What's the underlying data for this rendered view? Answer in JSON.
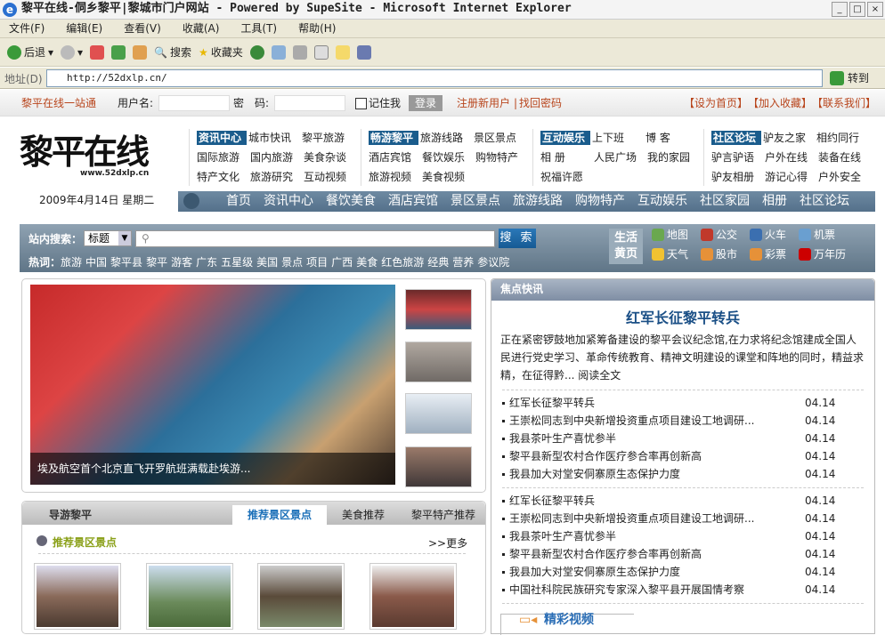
{
  "browser": {
    "title": "黎平在线-侗乡黎平|黎城市门户网站 - Powered by SupeSite - Microsoft Internet Explorer",
    "menu": [
      "文件(F)",
      "编辑(E)",
      "查看(V)",
      "收藏(A)",
      "工具(T)",
      "帮助(H)"
    ],
    "toolbar": {
      "back": "后退",
      "search": "搜索",
      "favorites": "收藏夹"
    },
    "address_label": "地址(D)",
    "address": "http://52dxlp.cn/",
    "go": "转到"
  },
  "login": {
    "site": "黎平在线一站通",
    "user_label": "用户名:",
    "pwd_label": "密　码:",
    "remember": "记住我",
    "login": "登录",
    "register": "注册新用户",
    "find_pwd": "找回密码",
    "set_home": "【设为首页】",
    "add_fav": "【加入收藏】",
    "contact": "【联系我们】"
  },
  "logo": {
    "text": "黎平在线",
    "url": "www.52dxlp.cn"
  },
  "date": "2009年4月14日 星期二",
  "categories": [
    {
      "head": "资讯中心",
      "items": [
        "城市快讯",
        "黎平旅游",
        "国际旅游",
        "国内旅游",
        "美食杂谈",
        "特产文化",
        "旅游研究",
        "互动视频"
      ]
    },
    {
      "head": "畅游黎平",
      "items": [
        "旅游线路",
        "景区景点",
        "酒店宾馆",
        "餐饮娱乐",
        "购物特产",
        "旅游视频",
        "美食视频"
      ]
    },
    {
      "head": "互动娱乐",
      "items": [
        "上下班",
        "博 客",
        "相 册",
        "人民广场",
        "我的家园",
        "祝福许愿"
      ]
    },
    {
      "head": "社区论坛",
      "items": [
        "驴友之家",
        "相约同行",
        "驴言驴语",
        "户外在线",
        "装备在线",
        "驴友相册",
        "游记心得",
        "户外安全"
      ]
    }
  ],
  "mainnav": [
    "首页",
    "资讯中心",
    "餐饮美食",
    "酒店宾馆",
    "景区景点",
    "旅游线路",
    "购物特产",
    "互动娱乐",
    "社区家园",
    "相册",
    "社区论坛"
  ],
  "search": {
    "label": "站内搜索：",
    "select": "标题",
    "button": "搜 索",
    "hot_label": "热词：",
    "hot": [
      "旅游",
      "中国",
      "黎平县",
      "黎平",
      "游客",
      "广东",
      "五星级",
      "美国",
      "景点",
      "项目",
      "广西",
      "美食",
      "红色旅游",
      "经典",
      "营养",
      "参议院"
    ]
  },
  "life": {
    "title1": "生活",
    "title2": "黄页",
    "items": [
      {
        "label": "地图",
        "icon": "map-icon",
        "color": "#6aa84f"
      },
      {
        "label": "公交",
        "icon": "bus-icon",
        "color": "#c0392b"
      },
      {
        "label": "火车",
        "icon": "train-icon",
        "color": "#3b6fb0"
      },
      {
        "label": "机票",
        "icon": "plane-icon",
        "color": "#6a9fd0"
      },
      {
        "label": "天气",
        "icon": "weather-icon",
        "color": "#f1c232"
      },
      {
        "label": "股市",
        "icon": "stock-icon",
        "color": "#e69138"
      },
      {
        "label": "彩票",
        "icon": "lottery-icon",
        "color": "#e69138"
      },
      {
        "label": "万年历",
        "icon": "clock-icon",
        "color": "#cc0000"
      }
    ]
  },
  "focus": {
    "caption": "埃及航空首个北京直飞开罗航班满载赴埃游..."
  },
  "guide": {
    "title": "导游黎平",
    "tabs": [
      "推荐景区景点",
      "美食推荐",
      "黎平特产推荐"
    ],
    "section": "推荐景区景点",
    "more": ">>更多"
  },
  "news": {
    "header": "焦点快讯",
    "headline": "红军长征黎平转兵",
    "summary": "正在紧密锣鼓地加紧筹备建设的黎平会议纪念馆,在力求将纪念馆建成全国人民进行党史学习、革命传统教育、精神文明建设的课堂和阵地的同时，精益求精，在征得黔... 阅读全文",
    "list1": [
      {
        "t": "红军长征黎平转兵",
        "d": "04.14"
      },
      {
        "t": "王崇松同志到中央新增投资重点项目建设工地调研...",
        "d": "04.14"
      },
      {
        "t": "我县茶叶生产喜忧参半",
        "d": "04.14"
      },
      {
        "t": "黎平县新型农村合作医疗参合率再创新高",
        "d": "04.14"
      },
      {
        "t": "我县加大对堂安侗寨原生态保护力度",
        "d": "04.14"
      }
    ],
    "list2": [
      {
        "t": "红军长征黎平转兵",
        "d": "04.14"
      },
      {
        "t": "王崇松同志到中央新增投资重点项目建设工地调研...",
        "d": "04.14"
      },
      {
        "t": "我县茶叶生产喜忧参半",
        "d": "04.14"
      },
      {
        "t": "黎平县新型农村合作医疗参合率再创新高",
        "d": "04.14"
      },
      {
        "t": "我县加大对堂安侗寨原生态保护力度",
        "d": "04.14"
      },
      {
        "t": "中国社科院民族研究专家深入黎平县开展国情考察",
        "d": "04.14"
      }
    ],
    "video": "精彩视频"
  }
}
